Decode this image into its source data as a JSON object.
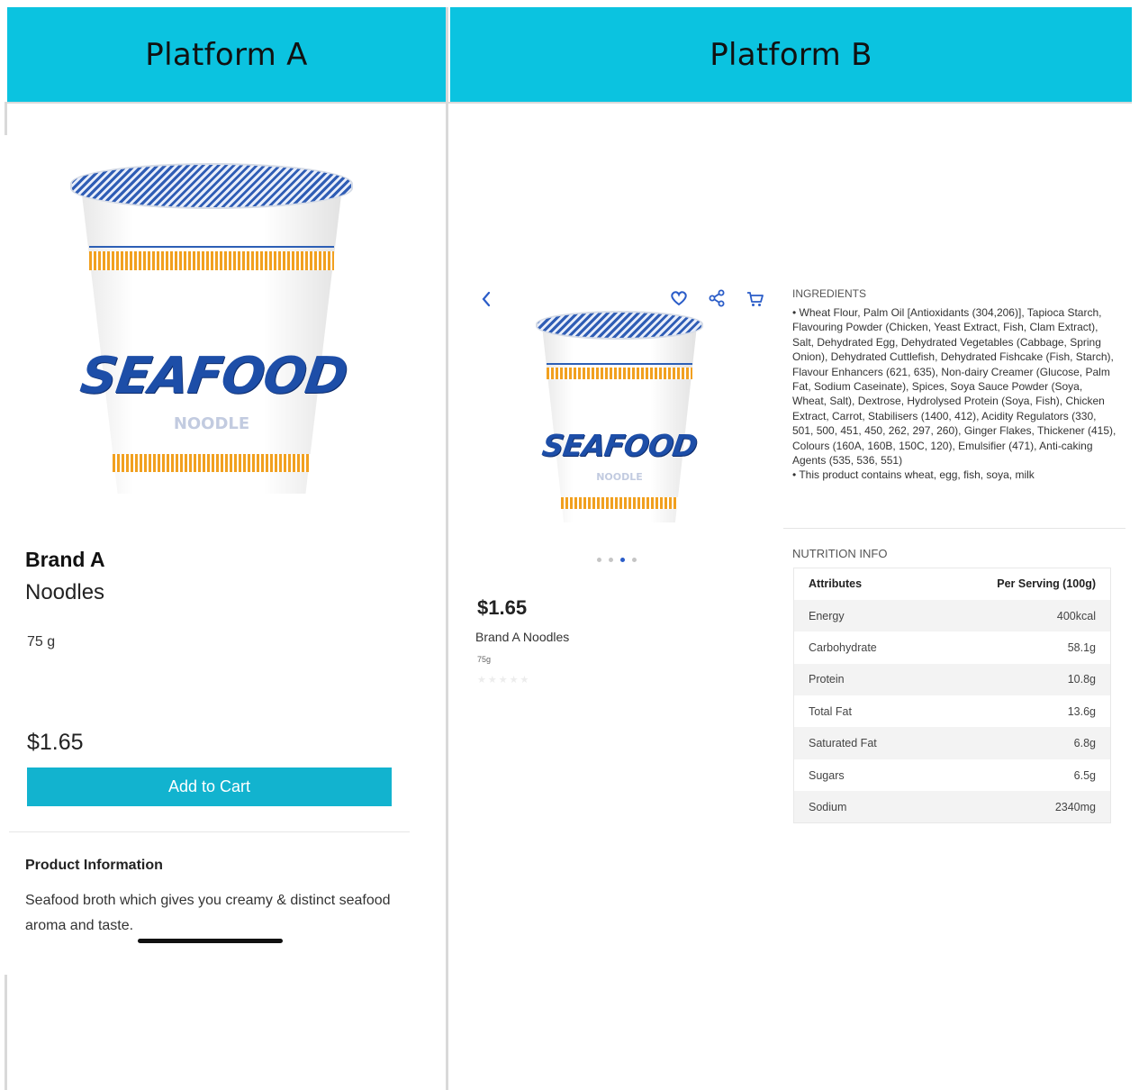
{
  "headers": {
    "platform_a": "Platform A",
    "platform_b": "Platform B"
  },
  "product_image": {
    "cup_word": "SEAFOOD",
    "cup_sub": "NOODLE"
  },
  "colors": {
    "header_bg": "#0bc3e0",
    "cart_button": "#12b3cf",
    "accent_blue": "#2a5cc8"
  },
  "platform_a": {
    "brand": "Brand A",
    "product_name": "Noodles",
    "weight": "75 g",
    "price": "$1.65",
    "add_to_cart": "Add to Cart",
    "info_title": "Product Information",
    "info_text": "Seafood broth which gives you creamy & distinct seafood aroma and taste."
  },
  "platform_b": {
    "icons": {
      "back": "chevron-left-icon",
      "favorite": "heart-icon",
      "share": "share-icon",
      "cart": "cart-icon"
    },
    "carousel": {
      "count": 4,
      "active_index": 2
    },
    "price": "$1.65",
    "product_name": "Brand A Noodles",
    "weight": "75g",
    "ingredients_title": "INGREDIENTS",
    "ingredients_text": "• Wheat Flour, Palm Oil [Antioxidants (304,206)], Tapioca Starch, Flavouring Powder (Chicken, Yeast Extract, Fish, Clam Extract), Salt, Dehydrated Egg, Dehydrated Vegetables (Cabbage, Spring Onion), Dehydrated Cuttlefish, Dehydrated Fishcake (Fish, Starch), Flavour Enhancers (621, 635), Non-dairy Creamer (Glucose, Palm Fat, Sodium Caseinate), Spices, Soya Sauce Powder (Soya, Wheat, Salt), Dextrose, Hydrolysed Protein (Soya, Fish), Chicken Extract, Carrot, Stabilisers (1400, 412), Acidity Regulators (330, 501, 500, 451, 450, 262, 297, 260), Ginger Flakes, Thickener (415), Colours (160A, 160B, 150C, 120), Emulsifier (471), Anti-caking Agents (535, 536, 551)",
    "allergen_text": "• This product contains wheat, egg, fish, soya, milk",
    "nutrition_title": "NUTRITION INFO",
    "nutrition_headers": {
      "attribute": "Attributes",
      "per_serving": "Per Serving (100g)"
    },
    "nutrition_rows": [
      {
        "label": "Energy",
        "value": "400kcal"
      },
      {
        "label": "Carbohydrate",
        "value": "58.1g"
      },
      {
        "label": "Protein",
        "value": "10.8g"
      },
      {
        "label": "Total Fat",
        "value": "13.6g"
      },
      {
        "label": "Saturated Fat",
        "value": "6.8g"
      },
      {
        "label": "Sugars",
        "value": "6.5g"
      },
      {
        "label": "Sodium",
        "value": "2340mg"
      }
    ]
  }
}
